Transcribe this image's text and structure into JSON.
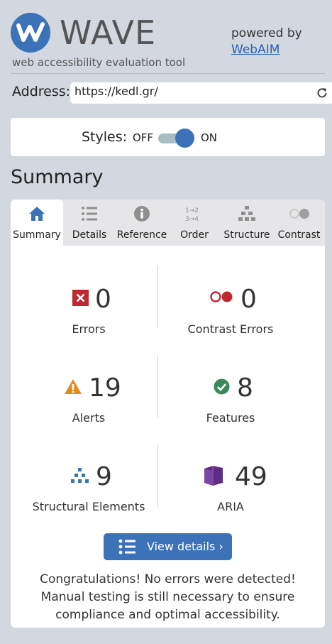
{
  "app": {
    "title": "WAVE",
    "tagline": "web accessibility evaluation tool",
    "powered_by": "powered by",
    "webaim_link": "WebAIM"
  },
  "address": {
    "label": "Address:",
    "value": "https://kedl.gr/"
  },
  "styles": {
    "label": "Styles:",
    "off_label": "OFF",
    "on_label": "ON",
    "enabled": true
  },
  "summary_heading": "Summary",
  "tabs": [
    {
      "label": "Summary",
      "icon": "home-icon",
      "active": true
    },
    {
      "label": "Details",
      "icon": "list-icon",
      "active": false
    },
    {
      "label": "Reference",
      "icon": "info-icon",
      "active": false
    },
    {
      "label": "Order",
      "icon": "order-icon",
      "active": false
    },
    {
      "label": "Structure",
      "icon": "structure-icon",
      "active": false
    },
    {
      "label": "Contrast",
      "icon": "contrast-icon",
      "active": false
    }
  ],
  "stats": {
    "errors": {
      "value": "0",
      "label": "Errors",
      "icon": "error-icon"
    },
    "contrast_errors": {
      "value": "0",
      "label": "Contrast Errors",
      "icon": "contrast-error-icon"
    },
    "alerts": {
      "value": "19",
      "label": "Alerts",
      "icon": "alert-icon"
    },
    "features": {
      "value": "8",
      "label": "Features",
      "icon": "feature-icon"
    },
    "structural": {
      "value": "9",
      "label": "Structural Elements",
      "icon": "structure-icon"
    },
    "aria": {
      "value": "49",
      "label": "ARIA",
      "icon": "aria-icon"
    }
  },
  "view_details_button": "View details ›",
  "congratulations": "Congratulations! No errors were detected! Manual testing is still necessary to ensure compliance and optimal accessibility.",
  "colors": {
    "brand_blue": "#3c73b8",
    "error_red": "#c0282f",
    "alert_orange": "#e38a1c",
    "feature_green": "#3a8a5a",
    "aria_purple": "#5e2d82",
    "background": "#d3d7df"
  }
}
